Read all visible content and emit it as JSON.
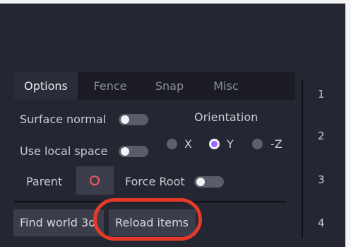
{
  "tabs": [
    {
      "label": "Options",
      "active": true
    },
    {
      "label": "Fence",
      "active": false
    },
    {
      "label": "Snap",
      "active": false
    },
    {
      "label": "Misc",
      "active": false
    }
  ],
  "options": {
    "surface_normal_label": "Surface normal",
    "use_local_space_label": "Use local space",
    "orientation_label": "Orientation",
    "orientation_options": [
      "X",
      "Y",
      "-Z"
    ],
    "orientation_selected": "Y",
    "parent_label": "Parent",
    "force_root_label": "Force Root"
  },
  "buttons": {
    "find_world": "Find world 3d",
    "reload_items": "Reload items"
  },
  "side_numbers": [
    "1",
    "2",
    "3",
    "4"
  ],
  "colors": {
    "background": "#242631",
    "tab_bar": "#1a1b24",
    "accent_radio": "#9c6bff",
    "parent_indicator": "#ef5b63",
    "annotation": "#e53a2a"
  }
}
